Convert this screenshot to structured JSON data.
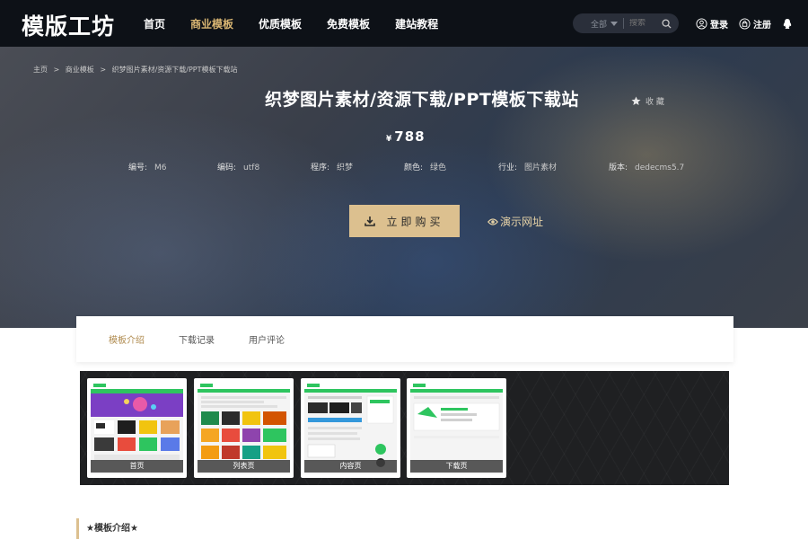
{
  "site": {
    "logo": "模版工坊"
  },
  "nav": [
    {
      "label": "首页",
      "active": false
    },
    {
      "label": "商业模板",
      "active": true
    },
    {
      "label": "优质模板",
      "active": false
    },
    {
      "label": "免费模板",
      "active": false
    },
    {
      "label": "建站教程",
      "active": false
    }
  ],
  "search": {
    "scope": "全部",
    "placeholder": "搜索"
  },
  "auth": {
    "login": "登录",
    "register": "注册"
  },
  "breadcrumb": {
    "home": "主页",
    "sep": ">",
    "category": "商业模板",
    "current": "织梦图片素材/资源下载/PPT模板下载站"
  },
  "product": {
    "title": "织梦图片素材/资源下载/PPT模板下载站",
    "favorite": "收 藏",
    "currency": "¥",
    "price": "788",
    "buy_label": "立即购买",
    "demo_label": "演示网址"
  },
  "meta": [
    {
      "key": "编号:",
      "value": "M6"
    },
    {
      "key": "编码:",
      "value": "utf8"
    },
    {
      "key": "程序:",
      "value": "织梦"
    },
    {
      "key": "颜色:",
      "value": "绿色"
    },
    {
      "key": "行业:",
      "value": "图片素材"
    },
    {
      "key": "版本:",
      "value": "dedecms5.7"
    }
  ],
  "tabs": [
    {
      "label": "模板介绍",
      "active": true
    },
    {
      "label": "下载记录",
      "active": false
    },
    {
      "label": "用户评论",
      "active": false
    }
  ],
  "thumbnails": [
    {
      "label": "首页"
    },
    {
      "label": "列表页"
    },
    {
      "label": "内容页"
    },
    {
      "label": "下载页"
    }
  ],
  "intro": {
    "heading": "★模板介绍★"
  },
  "colors": {
    "accent": "#dcc08f",
    "nav_active": "#d8b572",
    "topbar": "#0d1117",
    "thumb_green": "#2ec55f"
  }
}
